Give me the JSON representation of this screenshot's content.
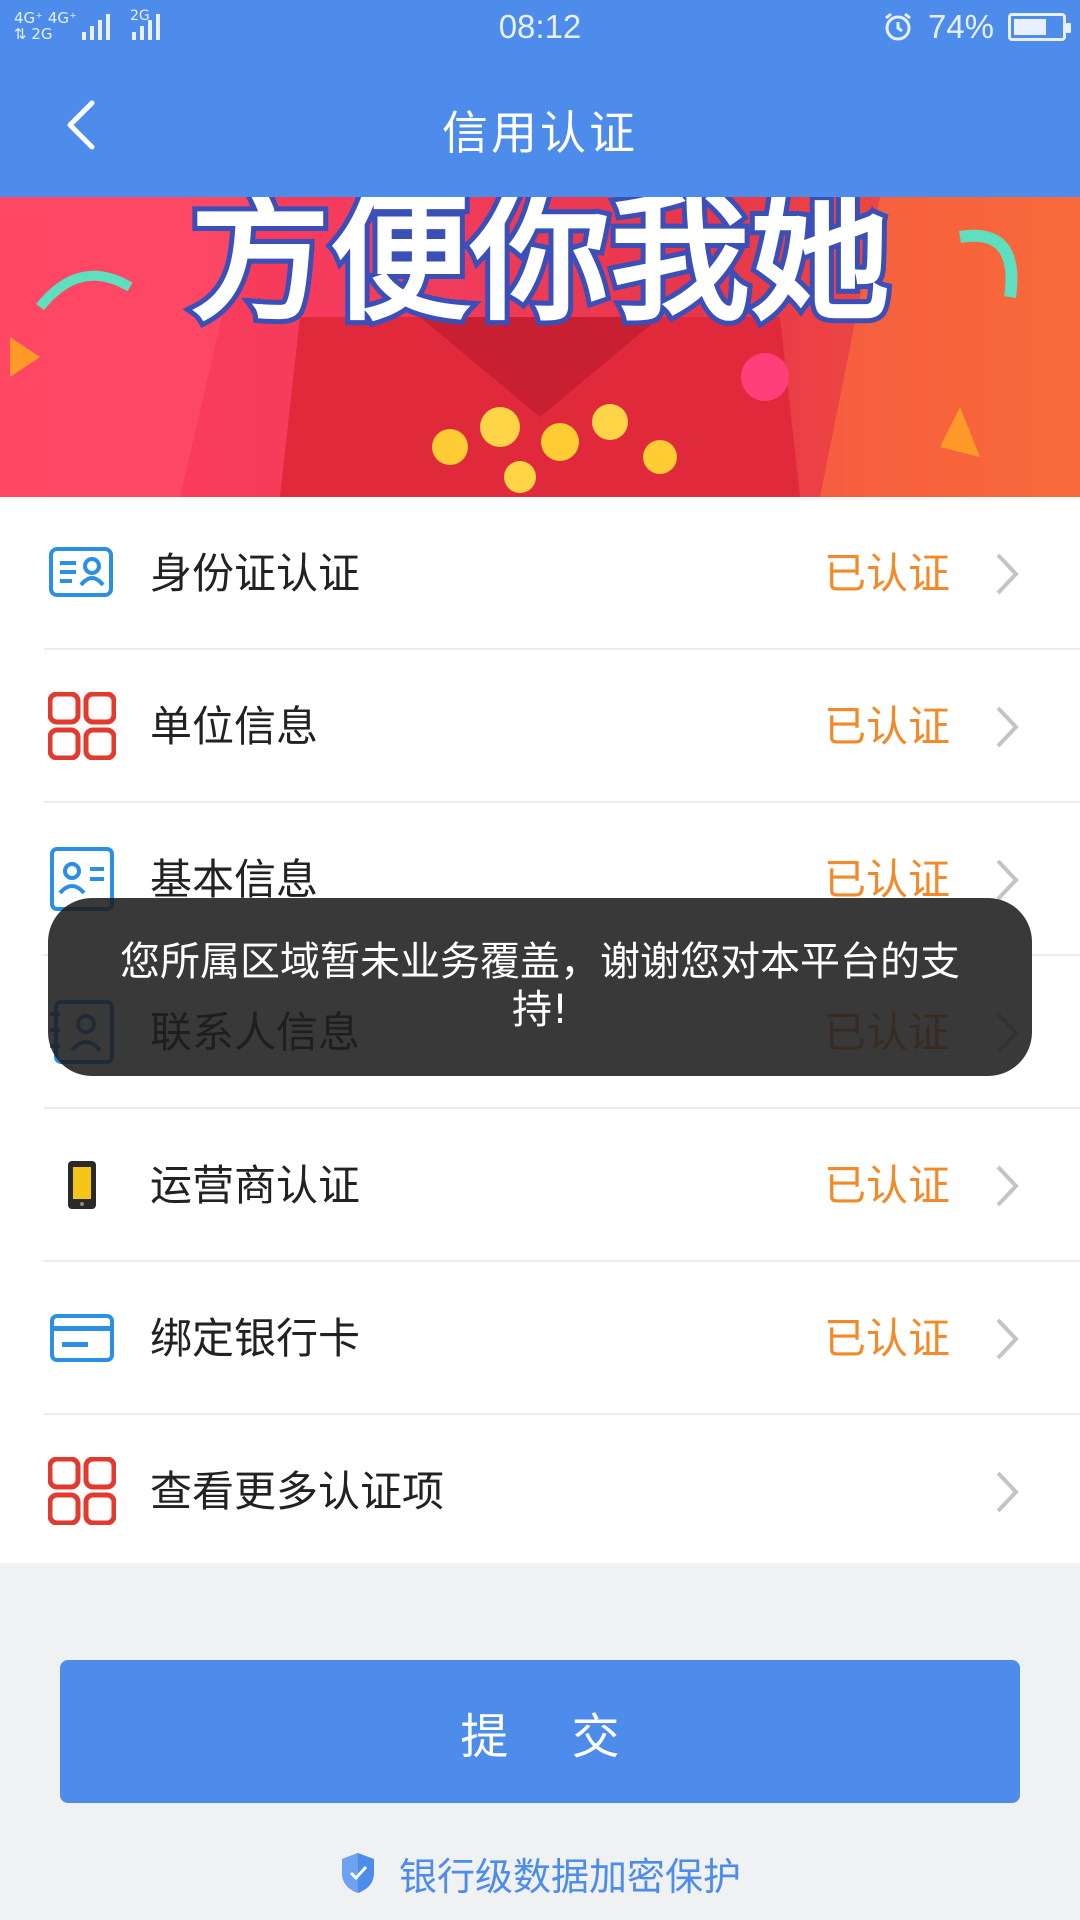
{
  "status_bar": {
    "network_top": "4G⁺ 4G⁺",
    "network_bottom": "⇅ 2G",
    "network_right": "2G",
    "time": "08:12",
    "battery": "74%",
    "battery_level": 0.74
  },
  "header": {
    "title": "信用认证"
  },
  "banner": {
    "text": "方便你我她",
    "icon": "promo-banner"
  },
  "list": {
    "items": [
      {
        "label": "身份证认证",
        "status": "已认证",
        "icon": "id-card-icon"
      },
      {
        "label": "单位信息",
        "status": "已认证",
        "icon": "grid-icon"
      },
      {
        "label": "基本信息",
        "status": "已认证",
        "icon": "profile-card-icon"
      },
      {
        "label": "联系人信息",
        "status": "已认证",
        "icon": "contact-icon"
      },
      {
        "label": "运营商认证",
        "status": "已认证",
        "icon": "phone-icon"
      },
      {
        "label": "绑定银行卡",
        "status": "已认证",
        "icon": "bank-card-icon"
      },
      {
        "label": "查看更多认证项",
        "status": "",
        "icon": "grid-icon"
      }
    ]
  },
  "toast": {
    "message": "您所属区域暂未业务覆盖，谢谢您对本平台的支持!"
  },
  "submit": {
    "label": "提 交"
  },
  "footer": {
    "security_text": "银行级数据加密保护",
    "icon": "shield-icon"
  },
  "colors": {
    "primary": "#4d8ceb",
    "verified": "#f38a2a",
    "icon_blue": "#2b8fe6",
    "icon_red": "#e23a2e"
  }
}
